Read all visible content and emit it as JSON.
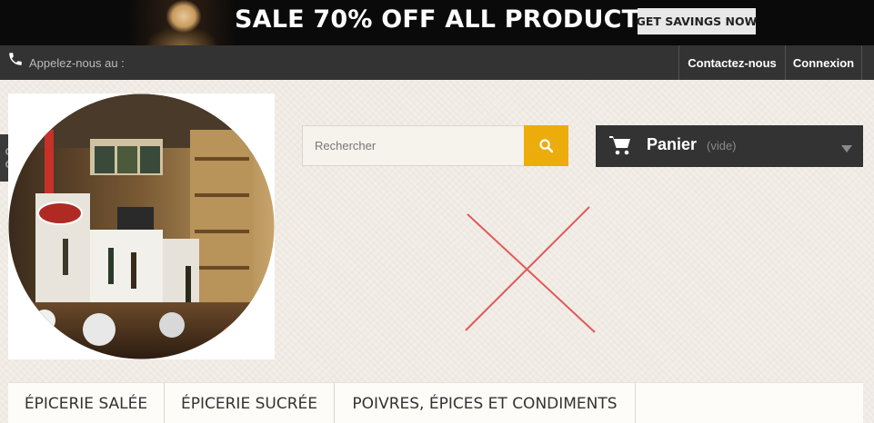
{
  "banner": {
    "headline": "SALE 70% OFF ALL PRODUCTS",
    "button_label": "GET SAVINGS NOW"
  },
  "topbar": {
    "call_text": "Appelez-nous au :",
    "contact_label": "Contactez-nous",
    "login_label": "Connexion",
    "phone_icon": "phone-icon"
  },
  "search": {
    "placeholder": "Rechercher",
    "button_icon": "search-icon",
    "accent_color": "#ecac0c"
  },
  "cart": {
    "label": "Panier",
    "status": "(vide)",
    "icon": "cart-icon"
  },
  "menu": {
    "items": [
      {
        "label": "ÉPICERIE SALÉE"
      },
      {
        "label": "ÉPICERIE SUCRÉE"
      },
      {
        "label": "POIVRES, ÉPICES ET CONDIMENTS"
      }
    ]
  },
  "colors": {
    "dark_bar": "#333333",
    "banner_bg": "#0a0a0a",
    "page_bg": "#f3efe8",
    "broken_image_x": "#e05a5a"
  }
}
